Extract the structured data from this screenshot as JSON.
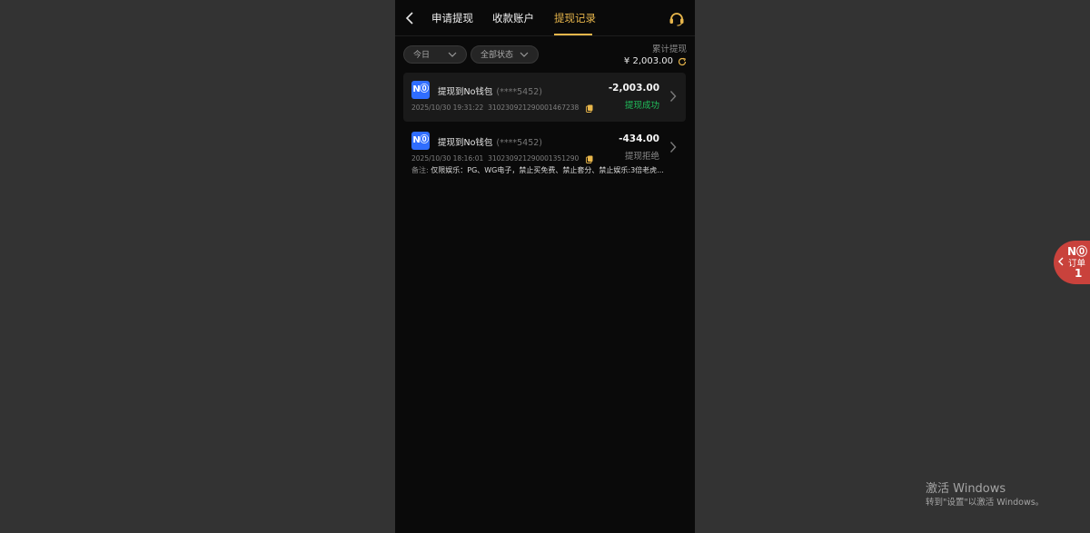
{
  "header": {
    "tabs": [
      {
        "label": "申请提现",
        "active": false
      },
      {
        "label": "收款账户",
        "active": false
      },
      {
        "label": "提现记录",
        "active": true
      }
    ]
  },
  "filters": {
    "date": "今日",
    "status": "全部状态"
  },
  "summary": {
    "label": "累计提现",
    "value": "¥ 2,003.00"
  },
  "records": [
    {
      "logo": "N⓪",
      "title": "提现到No钱包",
      "masked": "(****5452)",
      "datetime": "2025/10/30 19:31:22",
      "order_no": "310230921290001467238",
      "amount": "-2,003.00",
      "status": "提现成功"
    },
    {
      "logo": "N⓪",
      "title": "提现到No钱包",
      "masked": "(****5452)",
      "datetime": "2025/10/30 18:16:01",
      "order_no": "310230921290001351290",
      "amount": "-434.00",
      "status": "提现拒绝",
      "remark_label": "备注:",
      "remark": "仅限娱乐：PG、WG电子，禁止买免费、禁止套分、禁止娱乐:3倍老虎..."
    }
  ],
  "float_widget": {
    "brand": "N⓪",
    "label": "订单",
    "count": "1"
  },
  "watermark": {
    "title": "激活 Windows",
    "subtitle": "转到\"设置\"以激活 Windows。"
  },
  "colors": {
    "accent": "#e8b64b",
    "success": "#20c05c",
    "brand_blue": "#2f6dff",
    "float_red": "#c9423c"
  }
}
